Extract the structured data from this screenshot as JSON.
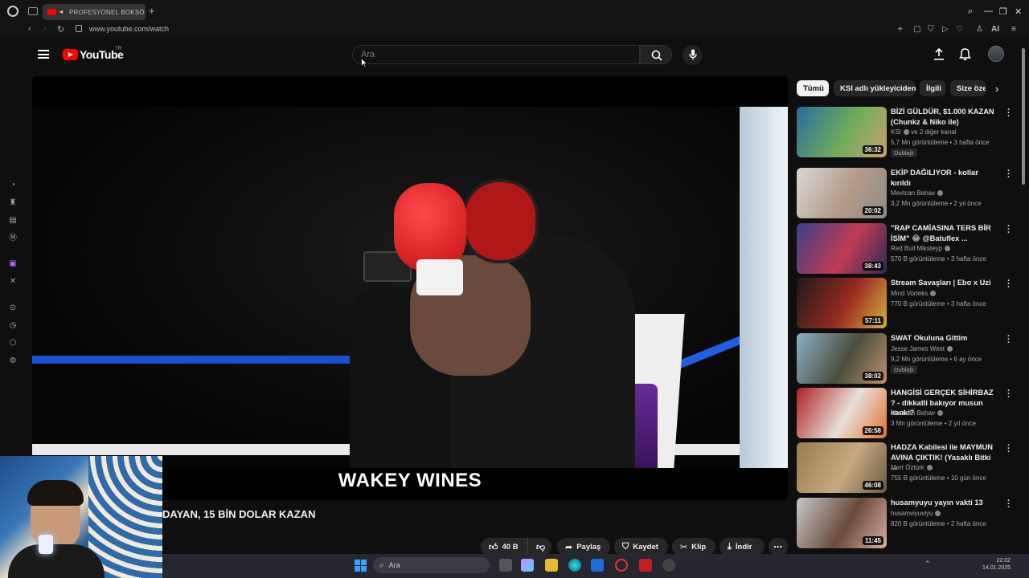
{
  "browser": {
    "tab_title": "PROFESYONEL BOKSÖ",
    "url": "www.youtube.com/watch",
    "ai_label": "AI"
  },
  "header": {
    "brand": "YouTube",
    "country": "TR",
    "search_placeholder": "Ara"
  },
  "video": {
    "caption": "WAKEY WINES",
    "title": "DAYAN, 15 BİN DOLAR KAZAN"
  },
  "actions": {
    "like_count": "40 B",
    "share": "Paylaş",
    "save": "Kaydet",
    "clip": "Klip",
    "download": "İndir"
  },
  "chips": [
    "Tümü",
    "KSI adlı yükleyiciden",
    "İlgili",
    "Size öze"
  ],
  "recommendations": [
    {
      "title": "BİZİ GÜLDÜR, $1.000 KAZAN (Chunkz & Niko ile)",
      "channel": "KSI",
      "channel_extra": "ve 2 diğer kanal",
      "meta": "5,7 Mn görüntüleme • 3 hafta önce",
      "duration": "36:32",
      "badge": "Dublajlı",
      "thumb_colors": [
        "#2a6a9a",
        "#6fae5a",
        "#c9a070"
      ]
    },
    {
      "title": "EKİP DAĞILIYOR - kollar kırıldı",
      "channel": "Mevtcan Bahav",
      "channel_extra": "",
      "meta": "3,2 Mn görüntüleme • 2 yıl önce",
      "duration": "20:02",
      "badge": "",
      "thumb_colors": [
        "#d8d8d8",
        "#b59a86",
        "#8b8b8b"
      ]
    },
    {
      "title": "\"RAP CAMİASINA TERS BİR İSİM\" 😂 @Batuflex ...",
      "channel": "Red Bull Miksteyp",
      "channel_extra": "",
      "meta": "570 B görüntüleme • 3 hafta önce",
      "duration": "38:43",
      "badge": "",
      "thumb_colors": [
        "#3a3f8a",
        "#c23b55",
        "#2b2b55"
      ]
    },
    {
      "title": "Stream Savaşları | Ebo x Uzi",
      "channel": "Mind Vorteks",
      "channel_extra": "",
      "meta": "770 B görüntüleme • 3 hafta önce",
      "duration": "57:11",
      "badge": "",
      "thumb_colors": [
        "#1a1a1a",
        "#9a2b20",
        "#d8b040"
      ]
    },
    {
      "title": "SWAT Okuluna Gittim",
      "channel": "Jesse James West",
      "channel_extra": "",
      "meta": "9,2 Mn görüntüleme • 6 ay önce",
      "duration": "38:02",
      "badge": "Dublajlı",
      "thumb_colors": [
        "#8ab0c8",
        "#4a4e3c",
        "#c09070"
      ]
    },
    {
      "title": "HANGİSİ GERÇEK SİHİRBAZ ? - dikkatli bakıyor musun kanki?",
      "channel": "Mevtcan Bahav",
      "channel_extra": "",
      "meta": "3 Mn görüntüleme • 2 yıl önce",
      "duration": "26:58",
      "badge": "",
      "thumb_colors": [
        "#b02020",
        "#e8e0d8",
        "#e07030"
      ]
    },
    {
      "title": "HADZA Kabilesi ile MAYMUN AVINA ÇIKTIK! (Yasaklı Bitki ...",
      "channel": "Mert Öztürk",
      "channel_extra": "",
      "meta": "755 B görüntüleme • 10 gün önce",
      "duration": "46:08",
      "badge": "",
      "thumb_colors": [
        "#9a7a50",
        "#c8a880",
        "#6a5a40"
      ]
    },
    {
      "title": "husamyuyu yayın vakti 13",
      "channel": "husamviyuviyu",
      "channel_extra": "",
      "meta": "820 B görüntüleme • 2 hafta önce",
      "duration": "11:45",
      "badge": "",
      "thumb_colors": [
        "#c8c8c8",
        "#6a4a3a",
        "#d8b0a0"
      ]
    }
  ],
  "taskbar": {
    "search_placeholder": "Ara",
    "time": "22:02",
    "date": "14.01.2025"
  }
}
